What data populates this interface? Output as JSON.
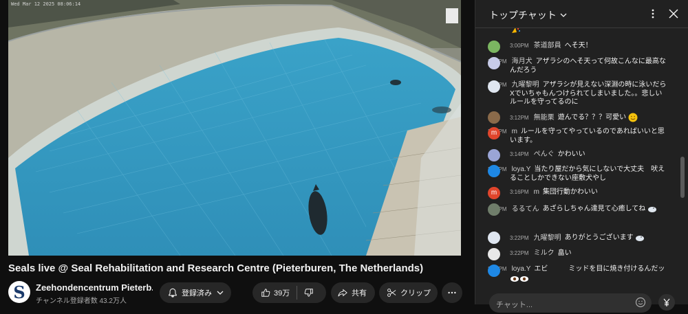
{
  "video": {
    "camera_timestamp": "Wed Mar 12 2025 08:06:14"
  },
  "title": "Seals live @ Seal Rehabilitation and Research Centre (Pieterburen, The Netherlands)",
  "channel": {
    "name": "Zeehondencentrum Pieterb...",
    "subscribers": "チャンネル登録者数 43.2万人",
    "avatar_letter": "S"
  },
  "actions": {
    "subscribed_label": "登録済み",
    "likes": "39万",
    "share_label": "共有",
    "clip_label": "クリップ"
  },
  "chat": {
    "title": "トップチャット",
    "input_placeholder": "チャット...",
    "messages": [
      {
        "time": "3:00PM",
        "author": "茶道部員",
        "text": "へそ天！",
        "avatar_color": "#7bb661"
      },
      {
        "time": "3:01PM",
        "author": "海月犬",
        "text": "アザラシのへそ天って何故こんなに最高なんだろう",
        "avatar_color": "#c7cbe8"
      },
      {
        "time": "3:10PM",
        "author": "九曜黎明",
        "text": "アザラシが見えない深淵の時に泳いだらXでいちゃもんつけられてしまいました。。悲しい　ルールを守ってるのに",
        "avatar_color": "#dfe6f0"
      },
      {
        "time": "3:12PM",
        "author": "無能栗",
        "text": "遊んでる？？？可愛い",
        "avatar_color": "#8a6a4a"
      },
      {
        "time": "3:13PM",
        "author": "m",
        "text": "ルールを守ってやっているのであればいいと思います。",
        "avatar_color": "#e0452c",
        "letter": "m"
      },
      {
        "time": "3:14PM",
        "author": "ぺんぐ",
        "text": "かわいい",
        "avatar_color": "#9aa5d6"
      },
      {
        "time": "3:15PM",
        "author": "loya.Y",
        "text": "当たり屋だから気にしないで大丈夫　吠えることしかできない座敷犬やし",
        "avatar_color": "#1e88e5"
      },
      {
        "time": "3:16PM",
        "author": "m",
        "text": "集団行動かわいい",
        "avatar_color": "#e0452c",
        "letter": "m"
      },
      {
        "time": "3:19PM",
        "author": "るるてん",
        "text": "あざらしちゃん達見て心癒してね",
        "avatar_color": "#6f7d6a"
      },
      {
        "time": "3:22PM",
        "author": "九曜黎明",
        "text": "ありがとうございます",
        "avatar_color": "#dfe6f0"
      },
      {
        "time": "3:22PM",
        "author": "ミルク",
        "text": "畠い",
        "avatar_color": "#e8e8e8"
      },
      {
        "time": "3:24PM",
        "author": "loya.Y",
        "text": "エビ　　　ミッドを目に焼き付けるんだッ",
        "avatar_color": "#1e88e5"
      }
    ]
  },
  "colors": {
    "accent": "#3ea6ff",
    "background": "#0f0f0f",
    "chat_bg": "#212121",
    "pool_water": "#3f9fc4"
  }
}
